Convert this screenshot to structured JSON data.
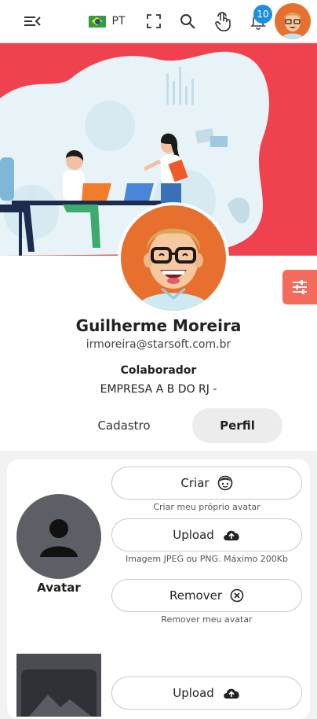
{
  "header": {
    "menu_icon": "menu-collapse-icon",
    "language_code": "PT",
    "flag_icon": "brazil-flag-icon",
    "fullscreen_icon": "fullscreen-icon",
    "search_icon": "search-icon",
    "touch_icon": "touch-pointer-icon",
    "notifications_icon": "bell-icon",
    "notification_count": "10"
  },
  "profile": {
    "name": "Guilherme Moreira",
    "email": "irmoreira@starsoft.com.br",
    "role": "Colaborador",
    "company": "EMPRESA A B DO RJ -"
  },
  "tabs": [
    {
      "label": "Cadastro",
      "active": false
    },
    {
      "label": "Perfil",
      "active": true
    }
  ],
  "avatar_section": {
    "label": "Avatar",
    "create_label": "Criar",
    "create_hint": "Criar meu próprio avatar",
    "upload_label": "Upload",
    "upload_hint": "Imagem JPEG ou PNG. Máximo 200Kb",
    "remove_label": "Remover",
    "remove_hint": "Remover meu avatar"
  },
  "cover_section": {
    "upload_label": "Upload"
  },
  "colors": {
    "banner": "#f0424e",
    "avatar_bg": "#e7702e",
    "settings_button": "#f26b5b",
    "badge": "#1b8fe0"
  }
}
